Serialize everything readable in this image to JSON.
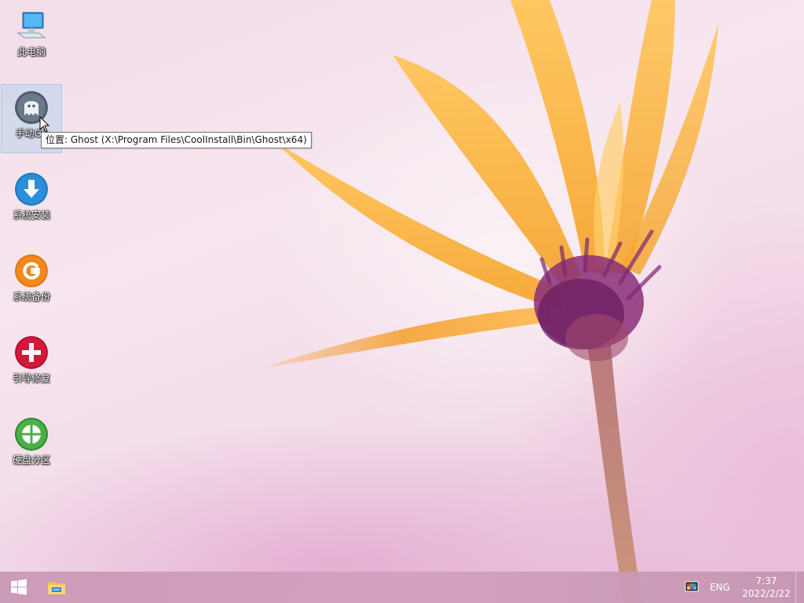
{
  "desktop": {
    "icons": [
      {
        "label": "此电脑",
        "icon": "computer-icon"
      },
      {
        "label": "手动Gh",
        "icon": "ghost-icon"
      },
      {
        "label": "系统安装",
        "icon": "download-arrow-icon"
      },
      {
        "label": "系统备份",
        "icon": "g-backup-icon"
      },
      {
        "label": "引导修复",
        "icon": "red-cross-icon"
      },
      {
        "label": "硬盘分区",
        "icon": "partition-icon"
      }
    ],
    "tooltip": "位置: Ghost (X:\\Program Files\\CoolInstall\\Bin\\Ghost\\x64)"
  },
  "taskbar": {
    "start_icon": "windows-logo-icon",
    "pinned": [
      {
        "icon": "file-explorer-icon"
      }
    ],
    "tray": {
      "network_icon": "network-display-icon",
      "language": "ENG",
      "time": "7:37",
      "date": "2022/2/22"
    }
  },
  "colors": {
    "accent_blue": "#2a8fd6",
    "accent_orange": "#f08a1c",
    "accent_red": "#d3183e",
    "accent_green": "#3ea33a",
    "ghost_gray": "#5a6a7a"
  }
}
